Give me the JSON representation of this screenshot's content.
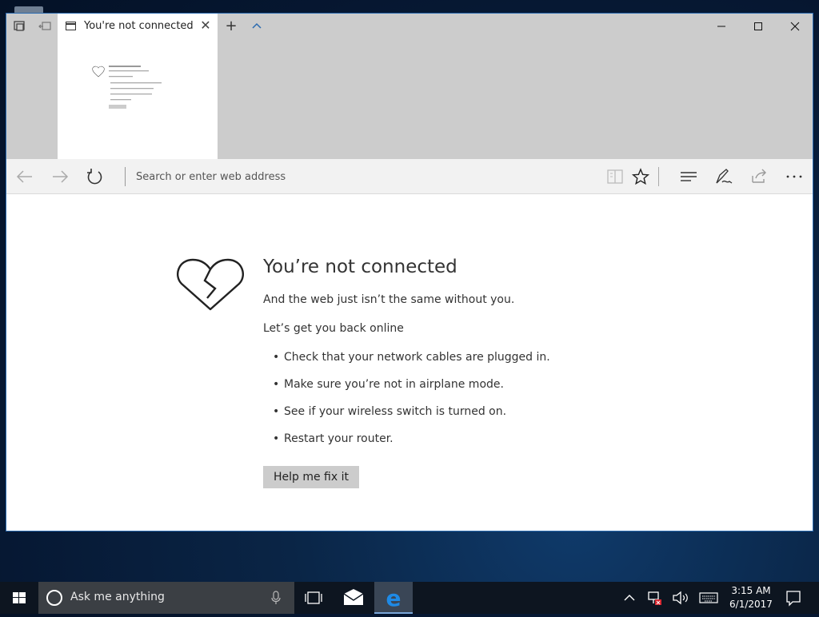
{
  "tab": {
    "title": "You're not connected",
    "close_glyph": "✕"
  },
  "titlebar": {
    "new_tab_glyph": "+",
    "tab_preview_glyph": "^"
  },
  "window_controls": {
    "minimize": "—",
    "maximize": "☐",
    "close": "✕"
  },
  "navbar": {
    "address_placeholder": "Search or enter web address"
  },
  "error_page": {
    "title": "You’re not connected",
    "subtitle": "And the web just isn’t the same without you.",
    "prompt": "Let’s get you back online",
    "tips": [
      "Check that your network cables are plugged in.",
      "Make sure you’re not in airplane mode.",
      "See if your wireless switch is turned on.",
      "Restart your router."
    ],
    "fix_button": "Help me fix it"
  },
  "taskbar": {
    "search_placeholder": "Ask me anything",
    "clock": {
      "time": "3:15 AM",
      "date": "6/1/2017"
    }
  },
  "icons": {
    "tab_page": "tab-page-icon",
    "back": "back-arrow-icon",
    "forward": "forward-arrow-icon",
    "refresh": "refresh-icon",
    "reading_view": "book-icon",
    "favorite": "star-icon",
    "hub": "hub-icon",
    "notes": "pen-icon",
    "share": "share-icon",
    "more": "more-icon",
    "broken_heart": "broken-heart-icon"
  },
  "colors": {
    "accent": "#2b6bb0",
    "titlebar": "#cccccc",
    "button": "#cccccc",
    "taskbar": "#0d1520"
  }
}
